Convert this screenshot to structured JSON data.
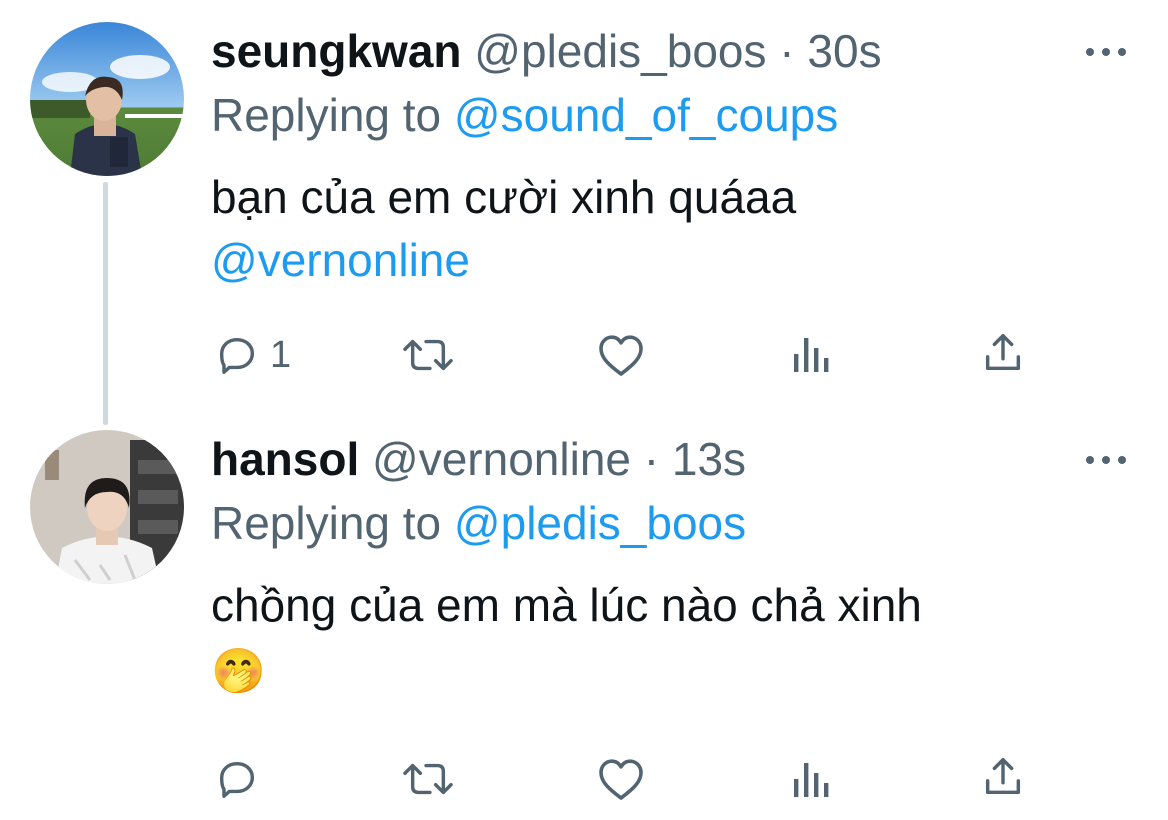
{
  "tweets": [
    {
      "name": "seungkwan",
      "handle": "@pledis_boos",
      "separator": "·",
      "time": "30s",
      "replying_prefix": "Replying to",
      "replying_to": "@sound_of_coups",
      "text_line1": "bạn của em cười xinh quáaa",
      "text_line2": "@vernonline",
      "reply_count": "1"
    },
    {
      "name": "hansol",
      "handle": "@vernonline",
      "separator": "·",
      "time": "13s",
      "replying_prefix": "Replying to",
      "replying_to": "@pledis_boos",
      "text_line1": "chồng của em mà lúc nào chả xinh",
      "text_line2": "🤭",
      "reply_count": ""
    }
  ],
  "icons": {
    "reply": "reply-icon",
    "retweet": "retweet-icon",
    "like": "heart-icon",
    "analytics": "analytics-icon",
    "share": "share-icon",
    "more": "more-icon"
  },
  "colors": {
    "link": "#1d9bf0",
    "secondary_text": "#536471",
    "primary_text": "#0f1419",
    "thread_line": "#cfd9de"
  }
}
